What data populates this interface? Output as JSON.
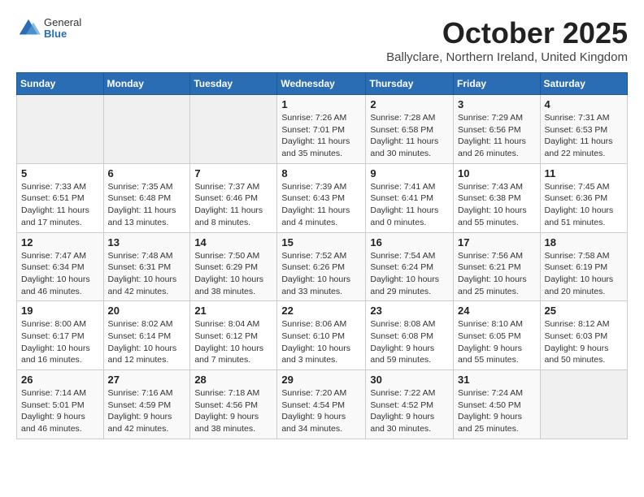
{
  "logo": {
    "general": "General",
    "blue": "Blue"
  },
  "title": "October 2025",
  "location": "Ballyclare, Northern Ireland, United Kingdom",
  "days_of_week": [
    "Sunday",
    "Monday",
    "Tuesday",
    "Wednesday",
    "Thursday",
    "Friday",
    "Saturday"
  ],
  "weeks": [
    [
      {
        "day": "",
        "info": ""
      },
      {
        "day": "",
        "info": ""
      },
      {
        "day": "",
        "info": ""
      },
      {
        "day": "1",
        "info": "Sunrise: 7:26 AM\nSunset: 7:01 PM\nDaylight: 11 hours\nand 35 minutes."
      },
      {
        "day": "2",
        "info": "Sunrise: 7:28 AM\nSunset: 6:58 PM\nDaylight: 11 hours\nand 30 minutes."
      },
      {
        "day": "3",
        "info": "Sunrise: 7:29 AM\nSunset: 6:56 PM\nDaylight: 11 hours\nand 26 minutes."
      },
      {
        "day": "4",
        "info": "Sunrise: 7:31 AM\nSunset: 6:53 PM\nDaylight: 11 hours\nand 22 minutes."
      }
    ],
    [
      {
        "day": "5",
        "info": "Sunrise: 7:33 AM\nSunset: 6:51 PM\nDaylight: 11 hours\nand 17 minutes."
      },
      {
        "day": "6",
        "info": "Sunrise: 7:35 AM\nSunset: 6:48 PM\nDaylight: 11 hours\nand 13 minutes."
      },
      {
        "day": "7",
        "info": "Sunrise: 7:37 AM\nSunset: 6:46 PM\nDaylight: 11 hours\nand 8 minutes."
      },
      {
        "day": "8",
        "info": "Sunrise: 7:39 AM\nSunset: 6:43 PM\nDaylight: 11 hours\nand 4 minutes."
      },
      {
        "day": "9",
        "info": "Sunrise: 7:41 AM\nSunset: 6:41 PM\nDaylight: 11 hours\nand 0 minutes."
      },
      {
        "day": "10",
        "info": "Sunrise: 7:43 AM\nSunset: 6:38 PM\nDaylight: 10 hours\nand 55 minutes."
      },
      {
        "day": "11",
        "info": "Sunrise: 7:45 AM\nSunset: 6:36 PM\nDaylight: 10 hours\nand 51 minutes."
      }
    ],
    [
      {
        "day": "12",
        "info": "Sunrise: 7:47 AM\nSunset: 6:34 PM\nDaylight: 10 hours\nand 46 minutes."
      },
      {
        "day": "13",
        "info": "Sunrise: 7:48 AM\nSunset: 6:31 PM\nDaylight: 10 hours\nand 42 minutes."
      },
      {
        "day": "14",
        "info": "Sunrise: 7:50 AM\nSunset: 6:29 PM\nDaylight: 10 hours\nand 38 minutes."
      },
      {
        "day": "15",
        "info": "Sunrise: 7:52 AM\nSunset: 6:26 PM\nDaylight: 10 hours\nand 33 minutes."
      },
      {
        "day": "16",
        "info": "Sunrise: 7:54 AM\nSunset: 6:24 PM\nDaylight: 10 hours\nand 29 minutes."
      },
      {
        "day": "17",
        "info": "Sunrise: 7:56 AM\nSunset: 6:21 PM\nDaylight: 10 hours\nand 25 minutes."
      },
      {
        "day": "18",
        "info": "Sunrise: 7:58 AM\nSunset: 6:19 PM\nDaylight: 10 hours\nand 20 minutes."
      }
    ],
    [
      {
        "day": "19",
        "info": "Sunrise: 8:00 AM\nSunset: 6:17 PM\nDaylight: 10 hours\nand 16 minutes."
      },
      {
        "day": "20",
        "info": "Sunrise: 8:02 AM\nSunset: 6:14 PM\nDaylight: 10 hours\nand 12 minutes."
      },
      {
        "day": "21",
        "info": "Sunrise: 8:04 AM\nSunset: 6:12 PM\nDaylight: 10 hours\nand 7 minutes."
      },
      {
        "day": "22",
        "info": "Sunrise: 8:06 AM\nSunset: 6:10 PM\nDaylight: 10 hours\nand 3 minutes."
      },
      {
        "day": "23",
        "info": "Sunrise: 8:08 AM\nSunset: 6:08 PM\nDaylight: 9 hours\nand 59 minutes."
      },
      {
        "day": "24",
        "info": "Sunrise: 8:10 AM\nSunset: 6:05 PM\nDaylight: 9 hours\nand 55 minutes."
      },
      {
        "day": "25",
        "info": "Sunrise: 8:12 AM\nSunset: 6:03 PM\nDaylight: 9 hours\nand 50 minutes."
      }
    ],
    [
      {
        "day": "26",
        "info": "Sunrise: 7:14 AM\nSunset: 5:01 PM\nDaylight: 9 hours\nand 46 minutes."
      },
      {
        "day": "27",
        "info": "Sunrise: 7:16 AM\nSunset: 4:59 PM\nDaylight: 9 hours\nand 42 minutes."
      },
      {
        "day": "28",
        "info": "Sunrise: 7:18 AM\nSunset: 4:56 PM\nDaylight: 9 hours\nand 38 minutes."
      },
      {
        "day": "29",
        "info": "Sunrise: 7:20 AM\nSunset: 4:54 PM\nDaylight: 9 hours\nand 34 minutes."
      },
      {
        "day": "30",
        "info": "Sunrise: 7:22 AM\nSunset: 4:52 PM\nDaylight: 9 hours\nand 30 minutes."
      },
      {
        "day": "31",
        "info": "Sunrise: 7:24 AM\nSunset: 4:50 PM\nDaylight: 9 hours\nand 25 minutes."
      },
      {
        "day": "",
        "info": ""
      }
    ]
  ]
}
